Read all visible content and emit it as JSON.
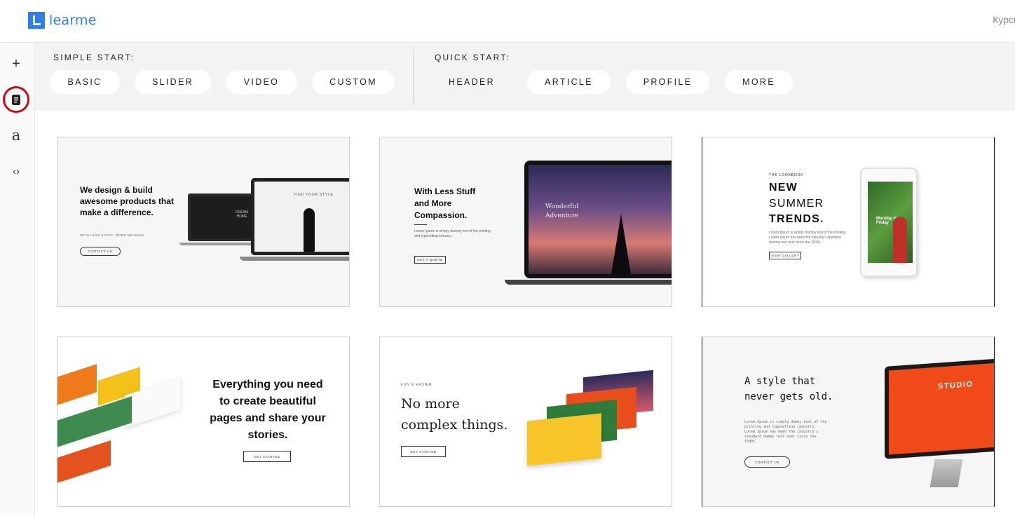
{
  "app": {
    "logo_text": "learme",
    "top_right_link": "Курсы"
  },
  "sidebar": {
    "items": [
      {
        "name": "add",
        "glyph": "+"
      },
      {
        "name": "page",
        "glyph": ""
      },
      {
        "name": "text",
        "glyph": "a"
      },
      {
        "name": "code",
        "glyph": "‹›"
      }
    ]
  },
  "toolbar": {
    "simple_label": "SIMPLE START:",
    "quick_label": "QUICK START:",
    "simple_buttons": [
      "BASIC",
      "SLIDER",
      "VIDEO",
      "CUSTOM"
    ],
    "quick_buttons": [
      "HEADER",
      "ARTICLE",
      "PROFILE",
      "MORE"
    ]
  },
  "cards": [
    {
      "title": "We design & build awesome products that make a difference.",
      "sub": "WITH LESS STUFF, MORE MEANING",
      "button": "CONTACT US",
      "screen_a": "DREAM HOME",
      "screen_b": "FIND YOUR STYLE"
    },
    {
      "title": "With Less Stuff and More Compassion.",
      "sub": "Lorem Ipsum is simply dummy text of the printing and typesetting industry.",
      "button": "GET A QUOTE",
      "screen": "Wonderful Adventure"
    },
    {
      "kicker": "THE LOOKBOOK",
      "title_1": "NEW",
      "title_2": "SUMMER",
      "title_3": "TRENDS.",
      "sub": "Lorem Ipsum is simply dummy text of the printing. Lorem Ipsum has been the industry's standard dummy text ever since the 1500s.",
      "button": "VIEW GALLERY",
      "phone_text": "Monday to Friday"
    },
    {
      "title": "Everything you need to create beautiful pages and share your stories.",
      "button": "GET STARTED"
    },
    {
      "kicker": "FUN & EASIER",
      "title": "No more complex things.",
      "button": "GET STARTED"
    },
    {
      "title": "A style that never gets old.",
      "sub": "Lorem Ipsum is simply dummy text of the printing and typesetting industry. Lorem Ipsum has been the industry's standard dummy text ever since the 1500s.",
      "button": "CONTACT US",
      "screen": "STUDIO"
    }
  ],
  "colors": {
    "brand": "#2f7ee8",
    "highlight": "#c80c13",
    "toolbar_bg": "#f3f3f3"
  }
}
